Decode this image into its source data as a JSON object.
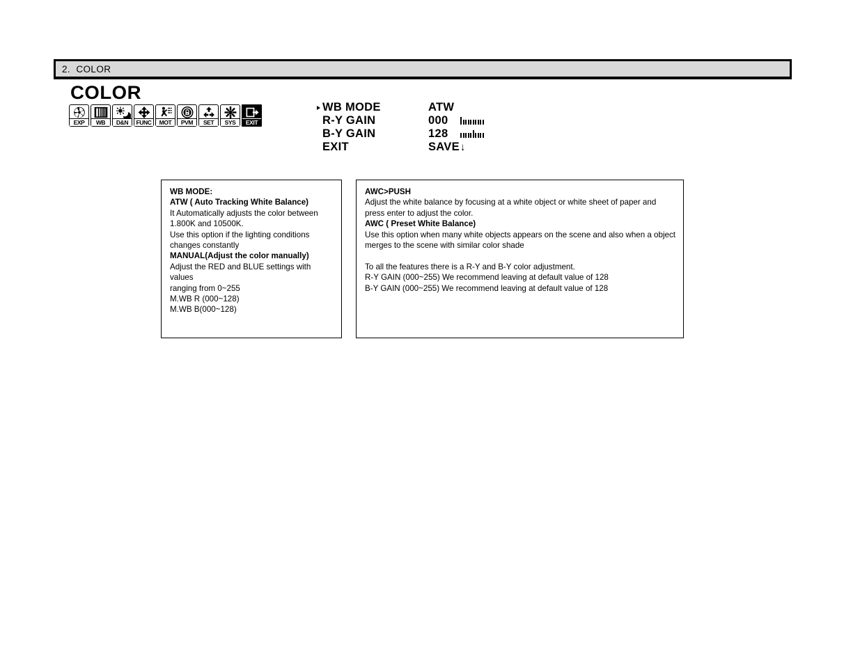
{
  "page": {
    "section_number_title": "2.  COLOR"
  },
  "osd": {
    "title": "COLOR",
    "icons": [
      {
        "label": "EXP",
        "icon": "aperture-iris-icon"
      },
      {
        "label": "WB",
        "icon": "white-balance-bars-icon"
      },
      {
        "label": "D&N",
        "icon": "sun-moon-day-night-icon"
      },
      {
        "label": "FUNC",
        "icon": "four-way-arrow-icon"
      },
      {
        "label": "MOT",
        "icon": "motion-running-person-icon"
      },
      {
        "label": "PVM",
        "icon": "privacy-mask-lock-icon"
      },
      {
        "label": "SET",
        "icon": "recycle-arrows-settings-icon"
      },
      {
        "label": "SYS",
        "icon": "snowflake-system-icon"
      },
      {
        "label": "EXIT",
        "icon": "exit-door-arrow-icon"
      }
    ],
    "menu": [
      {
        "label": "WB MODE",
        "value": "ATW",
        "selected": true,
        "slider": null
      },
      {
        "label": "R-Y GAIN",
        "value": "000",
        "selected": false,
        "slider": {
          "position": 0,
          "min": 0,
          "max": 255,
          "ticks": 9
        }
      },
      {
        "label": "B-Y GAIN",
        "value": "128",
        "selected": false,
        "slider": {
          "position": 128,
          "min": 0,
          "max": 255,
          "ticks": 9
        }
      },
      {
        "label": "EXIT",
        "value": "SAVE",
        "selected": false,
        "slider": null,
        "arrow": "↓"
      }
    ]
  },
  "desc_left": {
    "lines": [
      {
        "text": "WB MODE:",
        "bold": true
      },
      {
        "text": "ATW ( Auto Tracking White Balance)",
        "bold": true
      },
      {
        "text": "It Automatically adjusts the color  between",
        "bold": false
      },
      {
        "text": "1.800K and 10500K.",
        "bold": false
      },
      {
        "text": "Use this option if the lighting conditions",
        "bold": false
      },
      {
        "text": "changes constantly",
        "bold": false
      },
      {
        "text": "MANUAL(Adjust the color manually)",
        "bold": true
      },
      {
        "text": "Adjust the RED and BLUE settings with values",
        "bold": false
      },
      {
        "text": "ranging from 0~255",
        "bold": false
      },
      {
        "text": "M.WB R (000~128)",
        "bold": false
      },
      {
        "text": "M.WB B(000~128)",
        "bold": false
      }
    ]
  },
  "desc_right": {
    "lines": [
      {
        "text": "AWC>PUSH",
        "bold": true
      },
      {
        "text": "Adjust the white balance by  focusing at a white object or white sheet of paper  and",
        "bold": false
      },
      {
        "text": "press enter to adjust the color.",
        "bold": false
      },
      {
        "text": "AWC  ( Preset White Balance)",
        "bold": true
      },
      {
        "text": "Use this option when many white objects appears on the scene and also when a object",
        "bold": false
      },
      {
        "text": "merges to the scene with similar  color shade",
        "bold": false
      },
      {
        "text": "",
        "bold": false
      },
      {
        "text": "To  all the features there is a R-Y and B-Y color adjustment.",
        "bold": false
      },
      {
        "text": "R-Y  GAIN   (000~255) We recommend leaving at default value of 128",
        "bold": false
      },
      {
        "text": "B-Y GAIN    (000~255) We recommend leaving at default value of 128",
        "bold": false
      }
    ]
  },
  "colors": {
    "header_background": "#d9d9d9",
    "ink": "#000000",
    "page_background": "#ffffff"
  }
}
